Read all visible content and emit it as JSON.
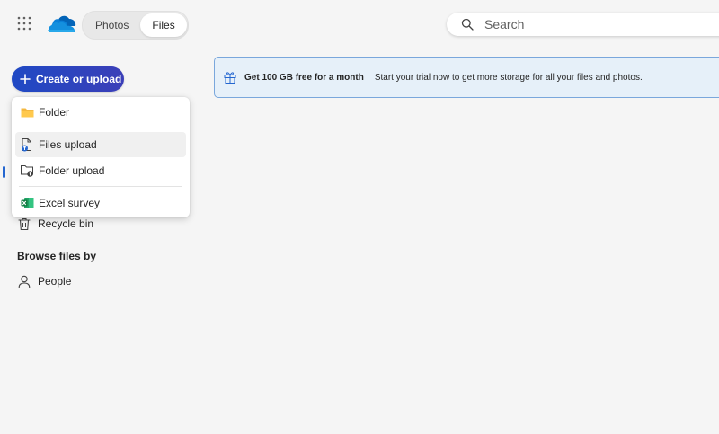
{
  "header": {
    "tabs": [
      {
        "label": "Photos",
        "active": false
      },
      {
        "label": "Files",
        "active": true
      }
    ],
    "search": {
      "placeholder": "Search"
    }
  },
  "sidebar": {
    "create_button": {
      "label": "Create or upload"
    },
    "menu": {
      "items": [
        {
          "label": "Folder",
          "icon": "folder-icon"
        },
        {
          "label": "Files upload",
          "icon": "file-upload-icon"
        },
        {
          "label": "Folder upload",
          "icon": "folder-upload-icon"
        },
        {
          "label": "Excel survey",
          "icon": "excel-icon"
        }
      ]
    },
    "recycle_bin": {
      "label": "Recycle bin",
      "icon": "recycle-bin-icon"
    },
    "browse_section": {
      "title": "Browse files by"
    },
    "people": {
      "label": "People",
      "icon": "person-icon"
    }
  },
  "banner": {
    "headline": "Get 100 GB free for a month",
    "message": "Start your trial now to get more storage for all your files and photos.",
    "icon": "gift-icon"
  },
  "colors": {
    "brand_blue": "#1f49c4",
    "accent": "#2466d0",
    "banner_bg": "#e6f0f9",
    "banner_border": "#7aa7dc",
    "background": "#f5f5f5"
  }
}
